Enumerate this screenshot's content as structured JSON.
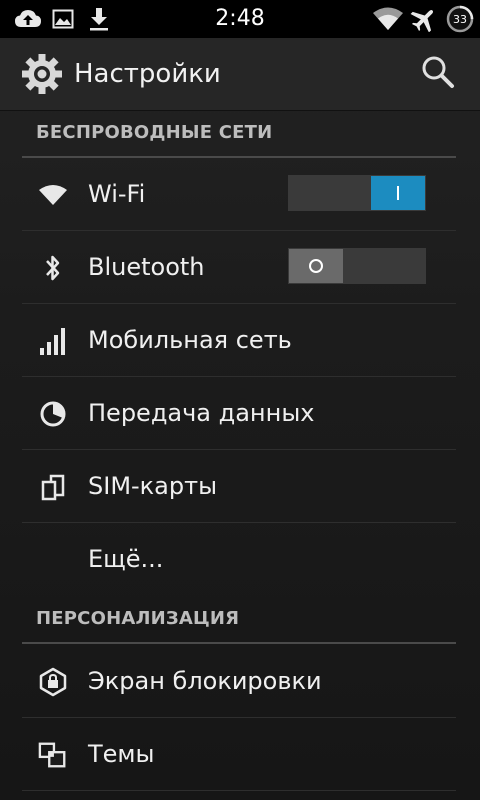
{
  "status_bar": {
    "time": "2:48",
    "battery_level": "33",
    "icons": [
      "cloud-upload-icon",
      "image-icon",
      "download-icon",
      "wifi-signal-icon",
      "airplane-mode-icon",
      "battery-icon"
    ]
  },
  "action_bar": {
    "title": "Настройки",
    "icon": "settings-gear-icon",
    "search_icon": "search-icon"
  },
  "sections": [
    {
      "header": "БЕСПРОВОДНЫЕ СЕТИ",
      "items": [
        {
          "label": "Wi-Fi",
          "icon": "wifi-icon",
          "toggle": "on"
        },
        {
          "label": "Bluetooth",
          "icon": "bluetooth-icon",
          "toggle": "off"
        },
        {
          "label": "Мобильная сеть",
          "icon": "cellular-signal-icon"
        },
        {
          "label": "Передача данных",
          "icon": "data-usage-icon"
        },
        {
          "label": "SIM-карты",
          "icon": "sim-cards-icon"
        },
        {
          "label": "Ещё...",
          "icon": ""
        }
      ]
    },
    {
      "header": "ПЕРСОНАЛИЗАЦИЯ",
      "items": [
        {
          "label": "Экран блокировки",
          "icon": "lock-screen-icon"
        },
        {
          "label": "Темы",
          "icon": "themes-icon"
        }
      ]
    }
  ],
  "colors": {
    "accent": "#1c8cc0",
    "background": "#1c1c1c",
    "text": "#f0f0f0",
    "section_header": "#bdbdbd"
  }
}
